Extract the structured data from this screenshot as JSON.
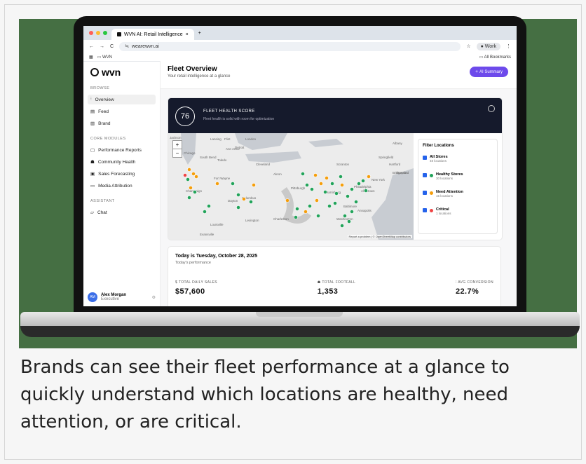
{
  "browser": {
    "tab_title": "WVN AI: Retail Intelligence",
    "new_tab": "+",
    "url": "wearewvn.ai",
    "bookmark": "WVN",
    "all_bookmarks": "All Bookmarks",
    "profile": "Work"
  },
  "sidebar": {
    "logo": "wvn",
    "browse_label": "BROWSE",
    "browse": [
      {
        "label": "Overview",
        "active": true
      },
      {
        "label": "Feed"
      },
      {
        "label": "Brand"
      }
    ],
    "core_label": "CORE MODULES",
    "core": [
      {
        "label": "Performance Reports"
      },
      {
        "label": "Community Health"
      },
      {
        "label": "Sales Forecasting"
      },
      {
        "label": "Media Attribution"
      }
    ],
    "assistant_label": "ASSISTANT",
    "assistant": [
      {
        "label": "Chat"
      }
    ],
    "user": {
      "initials": "AM",
      "name": "Alex Morgan",
      "role": "Executive"
    }
  },
  "header": {
    "title": "Fleet Overview",
    "subtitle": "Your retail intelligence at a glance",
    "ai_button": "AI Summary"
  },
  "health": {
    "score": "76",
    "title": "FLEET HEALTH SCORE",
    "subtitle": "Fleet health is solid with room for optimization"
  },
  "map": {
    "zoom_in": "+",
    "zoom_out": "−",
    "attribution": "Report a problem | © OpenStreetMap contributors",
    "cities": [
      "Jackson",
      "Lansing",
      "Flint",
      "London",
      "Detroit",
      "Ann Arbor",
      "Chicago",
      "South Bend",
      "Toledo",
      "Cleveland",
      "Fort Wayne",
      "Akron",
      "Columbus",
      "Dayton",
      "Champaign",
      "Pittsburgh",
      "Harrisburg",
      "Philadelphia",
      "New York",
      "Baltimore",
      "Washington",
      "Annapolis",
      "Richmond",
      "Louisville",
      "Lexington",
      "Charleston",
      "Allentown",
      "Scranton",
      "Hartford",
      "Albany",
      "Springfield",
      "Stamford",
      "Bridgeport",
      "Evansville"
    ]
  },
  "filter": {
    "title": "Filter Locations",
    "items": [
      {
        "label": "All Stores",
        "sub": "48 locations",
        "color": ""
      },
      {
        "label": "Healthy Stores",
        "sub": "30 locations",
        "color": "#22a35a"
      },
      {
        "label": "Need Attention",
        "sub": "15 locations",
        "color": "#f59e0b"
      },
      {
        "label": "Critical",
        "sub": "1 locations",
        "color": "#ef4444"
      }
    ]
  },
  "today": {
    "title": "Today is Tuesday, October 28, 2025",
    "subtitle": "Today's performance",
    "metrics": [
      {
        "label": "TOTAL DAILY SALES",
        "value": "$57,600"
      },
      {
        "label": "TOTAL FOOTFALL",
        "value": "1,353"
      },
      {
        "label": "AVG CONVERSION",
        "value": "22.7%"
      }
    ]
  },
  "caption": "Brands can see their fleet performance at a glance to quickly understand which locations are healthy, need attention, or are critical.",
  "colors": {
    "accent": "#6d4aeb",
    "banner": "#151a2c",
    "healthy": "#22a35a",
    "attention": "#f59e0b",
    "critical": "#ef4444",
    "background": "#456f43"
  }
}
